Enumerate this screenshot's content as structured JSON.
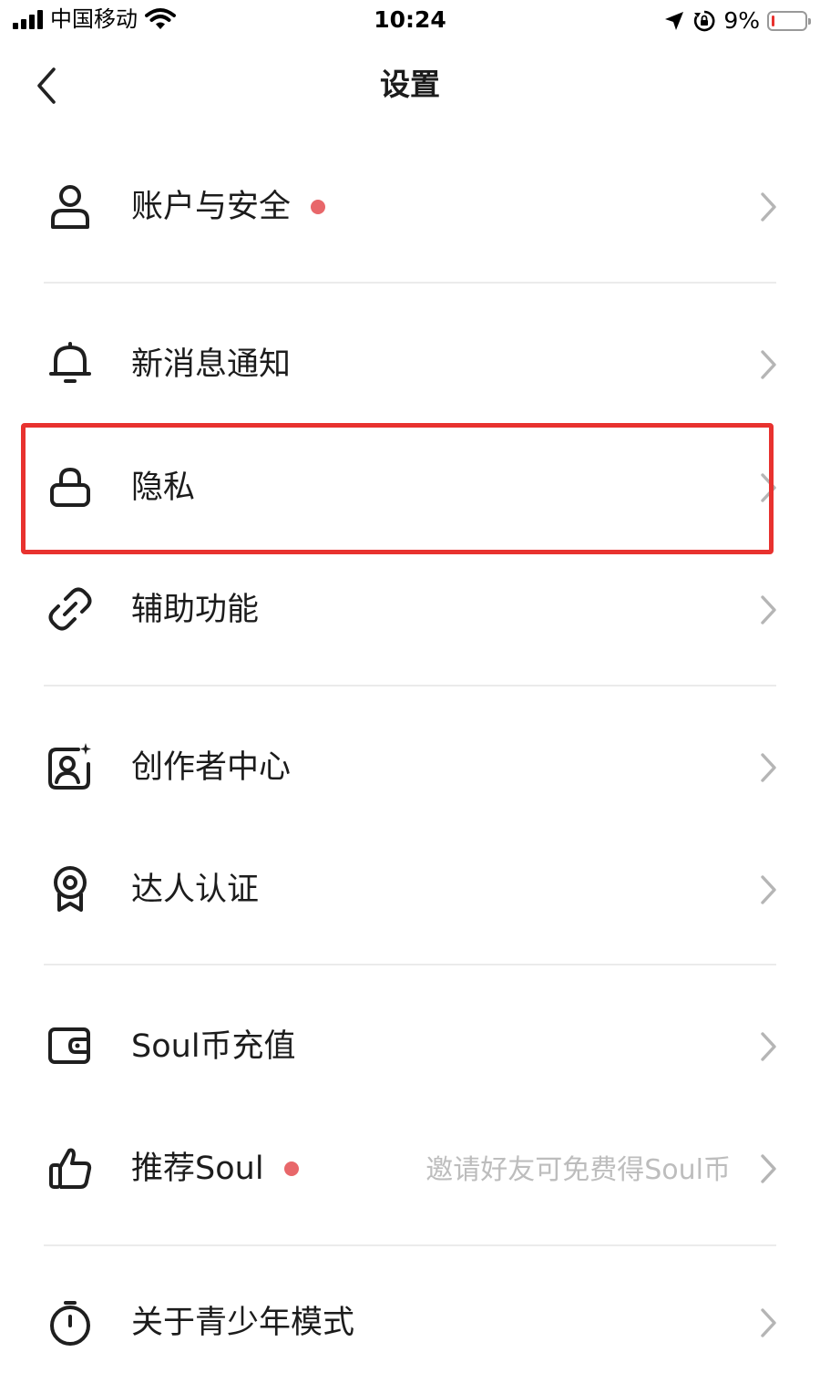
{
  "status_bar": {
    "carrier": "中国移动",
    "time": "10:24",
    "battery_percent": "9%",
    "battery_level": 0.09
  },
  "nav": {
    "title": "设置"
  },
  "menu": [
    {
      "label": "账户与安全",
      "icon": "user-icon",
      "badge_dot": true,
      "hint": ""
    },
    {
      "label": "新消息通知",
      "icon": "bell-icon",
      "badge_dot": false,
      "hint": ""
    },
    {
      "label": "隐私",
      "icon": "lock-icon",
      "badge_dot": false,
      "hint": "",
      "highlighted": true
    },
    {
      "label": "辅助功能",
      "icon": "link-icon",
      "badge_dot": false,
      "hint": ""
    },
    {
      "label": "创作者中心",
      "icon": "creator-icon",
      "badge_dot": false,
      "hint": ""
    },
    {
      "label": "达人认证",
      "icon": "badge-icon",
      "badge_dot": false,
      "hint": ""
    },
    {
      "label": "Soul币充值",
      "icon": "wallet-icon",
      "badge_dot": false,
      "hint": ""
    },
    {
      "label": "推荐Soul",
      "icon": "thumbs-up-icon",
      "badge_dot": true,
      "hint": "邀请好友可免费得Soul币"
    },
    {
      "label": "关于青少年模式",
      "icon": "clock-icon",
      "badge_dot": false,
      "hint": ""
    }
  ],
  "colors": {
    "badge_dot": "#E8676A",
    "highlight_border": "#E8322F",
    "chevron": "#B5B5B5",
    "hint_text": "#BDBDBD",
    "divider": "#EBEBEB"
  }
}
